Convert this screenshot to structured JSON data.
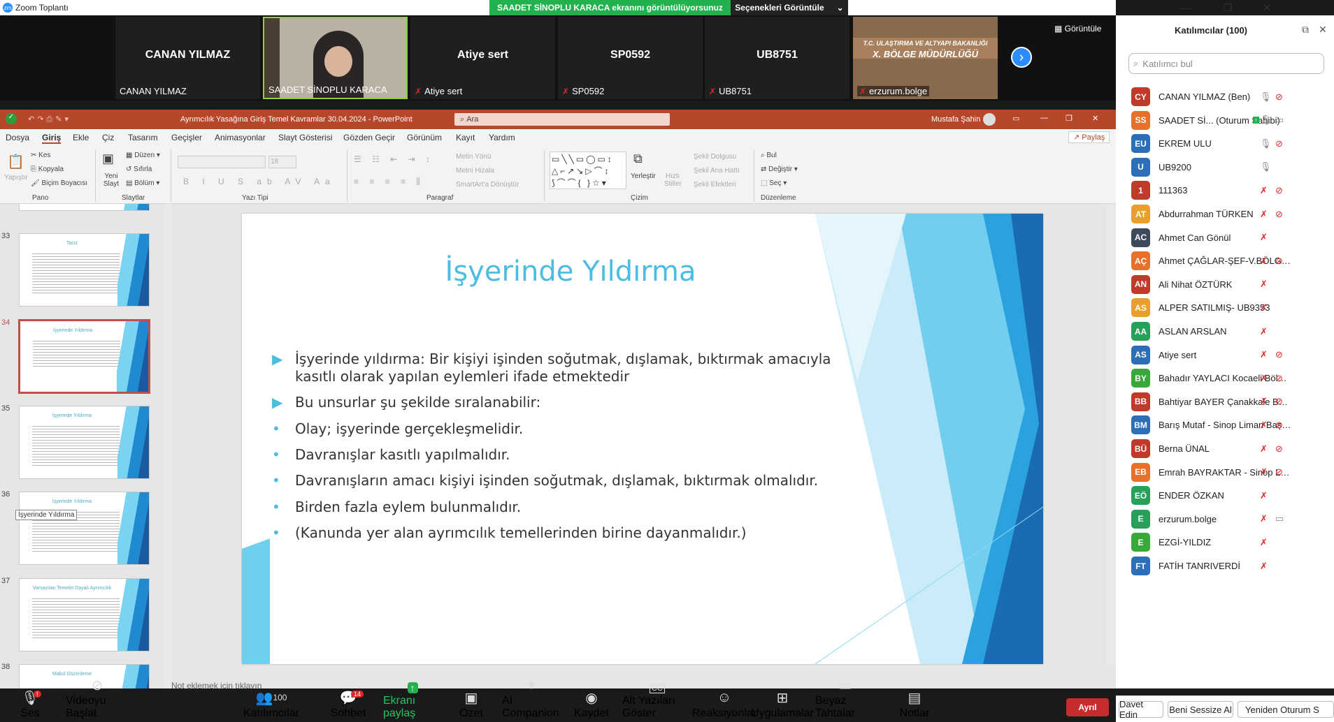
{
  "window": {
    "app_title": "Zoom Toplantı",
    "share_banner": "SAADET SİNOPLU KARACA ekranını görüntülüyorsunuz",
    "view_options": "Seçenekleri Görüntüle",
    "gallery_view": "Görüntüle"
  },
  "video_tiles": [
    {
      "big": "CANAN YILMAZ",
      "name": "CANAN YILMAZ",
      "muted": false
    },
    {
      "big": "",
      "name": "SAADET SİNOPLU KARACA",
      "muted": false
    },
    {
      "big": "Atiye sert",
      "name": "Atiye sert",
      "muted": true
    },
    {
      "big": "SP0592",
      "name": "SP0592",
      "muted": true
    },
    {
      "big": "UB8751",
      "name": "UB8751",
      "muted": true
    },
    {
      "big": "",
      "name": "erzurum.bolge",
      "muted": true,
      "sign_line1": "T.C. ULAŞTIRMA VE ALTYAPI BAKANLIĞI",
      "sign_line2": "X. BÖLGE MÜDÜRLÜĞÜ"
    }
  ],
  "ppt": {
    "doc_title": "Ayrımcılık Yasağına Giriş Temel Kavramlar 30.04.2024  -  PowerPoint",
    "search": "Ara",
    "user": "Mustafa Şahin",
    "share": "Paylaş",
    "menu": [
      "Dosya",
      "Giriş",
      "Ekle",
      "Çiz",
      "Tasarım",
      "Geçişler",
      "Animasyonlar",
      "Slayt Gösterisi",
      "Gözden Geçir",
      "Görünüm",
      "Kayıt",
      "Yardım"
    ],
    "ribbon": {
      "groups": [
        "Pano",
        "Slaytlar",
        "Yazı Tipi",
        "Paragraf",
        "Çizim",
        "Düzenleme"
      ],
      "pano": {
        "paste": "Yapıştır",
        "cut": "Kes",
        "copy": "Kopyala",
        "format_painter": "Biçim Boyacısı"
      },
      "slaytlar": {
        "new_slide": "Yeni Slayt",
        "layout": "Düzen",
        "reset": "Sıfırla",
        "section": "Bölüm"
      },
      "yazi": {
        "size": "18"
      },
      "paragraf": {
        "text_dir": "Metin Yönü",
        "align_text": "Metni Hizala",
        "smartart": "SmartArt'a Dönüştür"
      },
      "cizim": {
        "arrange": "Yerleştir",
        "quick_styles": "Hızlı Stiller",
        "fill": "Şekil Dolgusu",
        "outline": "Şekil Ana Hattı",
        "effects": "Şekil Efektleri"
      },
      "duzenleme": {
        "find": "Bul",
        "replace": "Değiştir",
        "select": "Seç"
      }
    },
    "thumbnails": [
      {
        "num": "33",
        "title": "Tacız"
      },
      {
        "num": "34",
        "title": "İşyerinde Yıldırma",
        "selected": true
      },
      {
        "num": "35",
        "title": "İşyerinde Yıldırma"
      },
      {
        "num": "36",
        "title": "İşyerinde Yıldırma",
        "tooltip": "İşyerinde Yıldırma"
      },
      {
        "num": "37",
        "title": "Varsayılan Temelin Dayalı Ayrımcılık"
      },
      {
        "num": "38",
        "title": "Makul Düzenleme"
      }
    ],
    "slide": {
      "title": "İşyerinde Yıldırma",
      "bullets": [
        {
          "text": "İşyerinde yıldırma: Bir kişiyi işinden soğutmak, dışlamak, bıktırmak amacıyla",
          "text2": "kasıtlı olarak yapılan eylemleri ifade etmektedir",
          "marker": "▶"
        },
        {
          "text": "Bu unsurlar şu şekilde sıralanabilir:",
          "marker": "▶"
        },
        {
          "text": "Olay; işyerinde gerçekleşmelidir.",
          "marker": "•"
        },
        {
          "text": "Davranışlar kasıtlı yapılmalıdır.",
          "marker": "•"
        },
        {
          "text": "Davranışların amacı kişiyi işinden soğutmak, dışlamak, bıktırmak olmalıdır.",
          "marker": "•"
        },
        {
          "text": " Birden fazla eylem bulunmalıdır.",
          "marker": "•"
        },
        {
          "text": "(Kanunda yer alan ayrımcılık temellerinden birine dayanmalıdır.)",
          "marker": "•"
        }
      ]
    },
    "notes_placeholder": "Not eklemek için tıklayın"
  },
  "toolbar": {
    "items": [
      {
        "label": "Ses",
        "icon": "microphone-icon"
      },
      {
        "label": "Videoyu Başlat",
        "icon": "video-off-icon"
      },
      {
        "label": "Katılımcılar",
        "icon": "participants-icon",
        "count": "100"
      },
      {
        "label": "Sohbet",
        "icon": "chat-icon",
        "badge": "14"
      },
      {
        "label": "Ekranı paylaş",
        "icon": "share-screen-icon"
      },
      {
        "label": "Özet",
        "icon": "summary-icon"
      },
      {
        "label": "AI Companion",
        "icon": "ai-companion-icon"
      },
      {
        "label": "Kaydet",
        "icon": "record-icon"
      },
      {
        "label": "Alt Yazıları Göster",
        "icon": "captions-icon"
      },
      {
        "label": "Reaksiyonlar",
        "icon": "reactions-icon"
      },
      {
        "label": "Uygulamalar",
        "icon": "apps-icon"
      },
      {
        "label": "Beyaz Tahtalar",
        "icon": "whiteboard-icon"
      },
      {
        "label": "Notlar",
        "icon": "notes-icon"
      }
    ],
    "leave": "Ayrıl",
    "audio_badge": "!",
    "cc_glyph": "CC"
  },
  "participants": {
    "title": "Katılımcılar (100)",
    "search_placeholder": "Katılımcı bul",
    "list": [
      {
        "initials": "CY",
        "name": "CANAN YILMAZ (Ben)",
        "color": "#c0392b",
        "mic": "on",
        "cam": "off"
      },
      {
        "initials": "SS",
        "name": "SAADET Sİ...  (Oturum Sahibi)",
        "color": "#e8702a",
        "mic": "on",
        "cam": "on",
        "share": true
      },
      {
        "initials": "EU",
        "name": "EKREM ULU",
        "color": "#2d6fb7",
        "mic": "on",
        "cam": "off"
      },
      {
        "initials": "U",
        "name": "UB9200",
        "color": "#2d6fb7",
        "mic": "on",
        "cam": "none"
      },
      {
        "initials": "1",
        "name": "111363",
        "color": "#c0392b",
        "mic": "off",
        "cam": "off"
      },
      {
        "initials": "AT",
        "name": "Abdurrahman TÜRKEN",
        "color": "#e8a02a",
        "mic": "off",
        "cam": "off"
      },
      {
        "initials": "AC",
        "name": "Ahmet Can Gönül",
        "color": "#3c4a5a",
        "mic": "off",
        "cam": "none"
      },
      {
        "initials": "AÇ",
        "name": "Ahmet ÇAĞLAR-ŞEF-V.BÖLGE ...",
        "color": "#e8702a",
        "mic": "off",
        "cam": "off"
      },
      {
        "initials": "AN",
        "name": "Ali Nihat ÖZTÜRK",
        "color": "#c0392b",
        "mic": "off",
        "cam": "none"
      },
      {
        "initials": "AS",
        "name": "ALPER SATILMIŞ- UB9353",
        "color": "#e8a02a",
        "mic": "off",
        "cam": "none"
      },
      {
        "initials": "AA",
        "name": "ASLAN ARSLAN",
        "color": "#27a05a",
        "mic": "off",
        "cam": "none"
      },
      {
        "initials": "AS",
        "name": "Atiye sert",
        "color": "#2d6fb7",
        "mic": "off",
        "cam": "off"
      },
      {
        "initials": "BY",
        "name": "Bahadır YAYLACI Kocaeli Bölge ...",
        "color": "#38a838",
        "mic": "off",
        "cam": "off"
      },
      {
        "initials": "BB",
        "name": "Bahtiyar BAYER Çanakkale Bölge Li...",
        "color": "#c0392b",
        "mic": "off",
        "cam": "off"
      },
      {
        "initials": "BM",
        "name": "Barış Mutaf - Sinop Liman Başk...",
        "color": "#2d6fb7",
        "mic": "off",
        "cam": "off"
      },
      {
        "initials": "BÜ",
        "name": "Berna ÜNAL",
        "color": "#c0392b",
        "mic": "off",
        "cam": "off"
      },
      {
        "initials": "EB",
        "name": "Emrah BAYRAKTAR - Sinop Lim...",
        "color": "#e8702a",
        "mic": "off",
        "cam": "off"
      },
      {
        "initials": "EÖ",
        "name": "ENDER ÖZKAN",
        "color": "#27a05a",
        "mic": "off",
        "cam": "none"
      },
      {
        "initials": "E",
        "name": "erzurum.bolge",
        "color": "#27a05a",
        "mic": "off",
        "cam": "on"
      },
      {
        "initials": "E",
        "name": "EZGİ-YILDIZ",
        "color": "#38a838",
        "mic": "off",
        "cam": "none"
      },
      {
        "initials": "FT",
        "name": "FATİH TANRIVERDİ",
        "color": "#2d6fb7",
        "mic": "off",
        "cam": "none"
      }
    ],
    "footer": [
      "Davet Edin",
      "Beni Sessize Al",
      "Yeniden Oturum S"
    ]
  }
}
